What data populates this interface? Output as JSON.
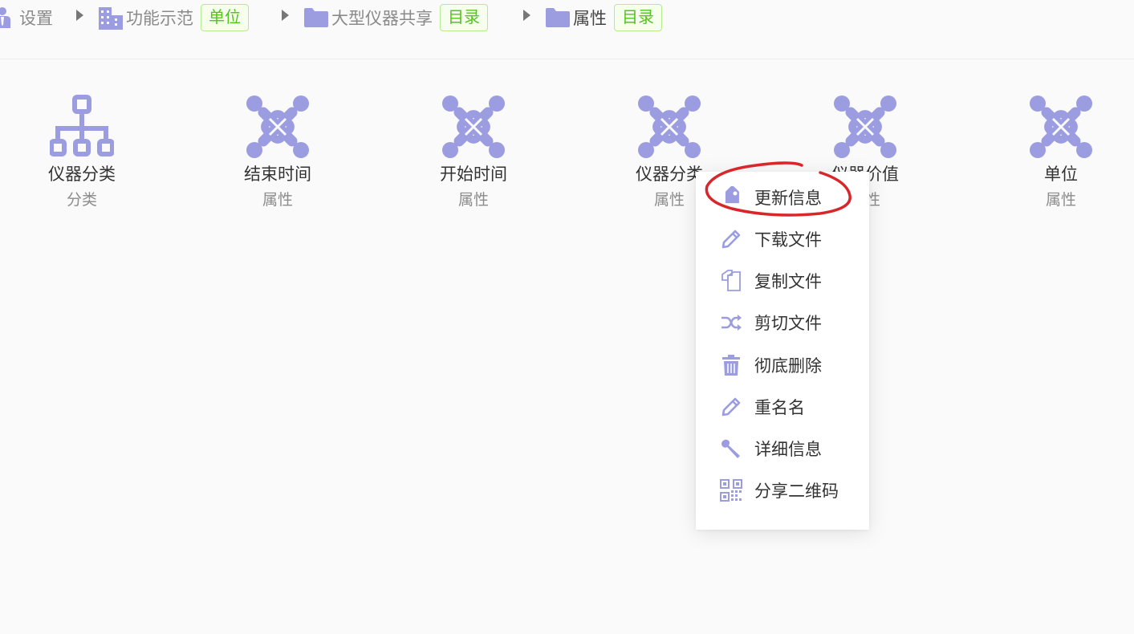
{
  "breadcrumb": {
    "root": {
      "label": "设置"
    },
    "org": {
      "label": "功能示范",
      "tag": "单位"
    },
    "folder": {
      "label": "大型仪器共享",
      "tag": "目录"
    },
    "current": {
      "label": "属性",
      "tag": "目录"
    }
  },
  "items": [
    {
      "name": "仪器分类",
      "type": "分类",
      "icon": "hierarchy-icon"
    },
    {
      "name": "结束时间",
      "type": "属性",
      "icon": "joomla-icon"
    },
    {
      "name": "开始时间",
      "type": "属性",
      "icon": "joomla-icon"
    },
    {
      "name": "仪器分类",
      "type": "属性",
      "icon": "joomla-icon"
    },
    {
      "name": "仪器价值",
      "type": "属性",
      "icon": "joomla-icon"
    },
    {
      "name": "单位",
      "type": "属性",
      "icon": "joomla-icon"
    }
  ],
  "context_menu": {
    "items": [
      {
        "label": "更新信息",
        "icon": "tag-icon"
      },
      {
        "label": "下载文件",
        "icon": "pencil-icon"
      },
      {
        "label": "复制文件",
        "icon": "copy-icon"
      },
      {
        "label": "剪切文件",
        "icon": "shuffle-icon"
      },
      {
        "label": "彻底删除",
        "icon": "trash-icon"
      },
      {
        "label": "重名名",
        "icon": "pencil-icon"
      },
      {
        "label": "详细信息",
        "icon": "wrench-icon"
      },
      {
        "label": "分享二维码",
        "icon": "qrcode-icon"
      }
    ]
  },
  "colors": {
    "icon": "#9b9de0",
    "tag_green": "#52c41a",
    "annotation_red": "#d9262a"
  }
}
